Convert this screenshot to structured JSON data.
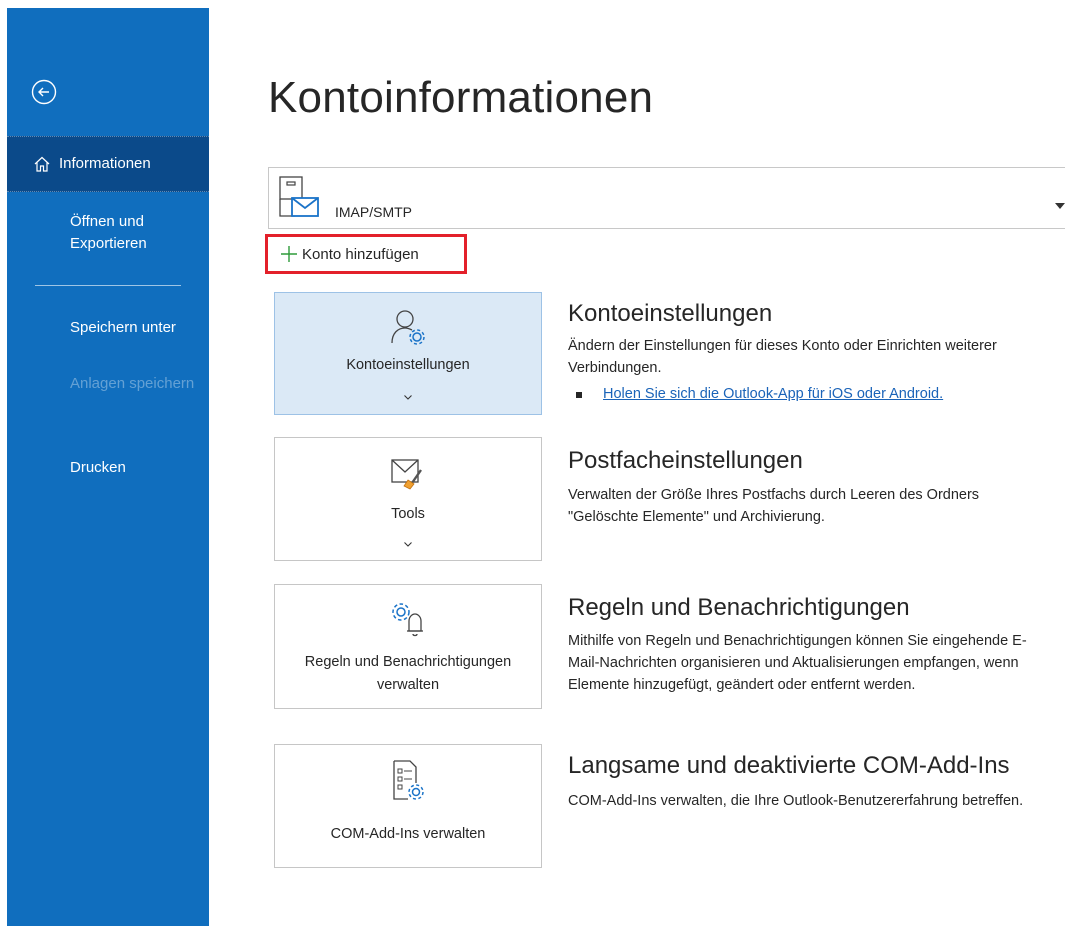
{
  "sidebar": {
    "back_label": "",
    "items": [
      {
        "label": "Informationen"
      },
      {
        "label": "Öffnen und Exportieren"
      },
      {
        "label": "Speichern unter"
      },
      {
        "label": "Anlagen speichern"
      },
      {
        "label": "Drucken"
      }
    ]
  },
  "main": {
    "title": "Kontoinformationen",
    "account_select": {
      "value": "IMAP/SMTP"
    },
    "add_account_label": "Konto hinzufügen",
    "sections": [
      {
        "tile_label": "Kontoeinstellungen",
        "heading": "Kontoeinstellungen",
        "description": "Ändern der Einstellungen für dieses Konto oder Einrichten weiterer Verbindungen.",
        "link": "Holen Sie sich die Outlook-App für iOS oder Android."
      },
      {
        "tile_label": "Tools",
        "heading": "Postfacheinstellungen",
        "description": "Verwalten der Größe Ihres Postfachs durch Leeren des Ordners \"Gelöschte Elemente\" und Archivierung."
      },
      {
        "tile_label": "Regeln und Benachrichtigungen verwalten",
        "heading": "Regeln und Benachrichtigungen",
        "description": "Mithilfe von Regeln und Benachrichtigungen können Sie eingehende E-Mail-Nachrichten organisieren und Aktualisierungen empfangen, wenn Elemente hinzugefügt, geändert oder entfernt werden."
      },
      {
        "tile_label": "COM-Add-Ins verwalten",
        "heading": "Langsame und deaktivierte COM-Add-Ins",
        "description": "COM-Add-Ins verwalten, die Ihre Outlook-Benutzererfahrung betreffen."
      }
    ]
  },
  "colors": {
    "sidebar": "#106ebe",
    "sidebar_active": "#0b4a8a",
    "highlight_border": "#e3202a",
    "link": "#1a63b8",
    "tile_selected": "#dbe9f6"
  }
}
